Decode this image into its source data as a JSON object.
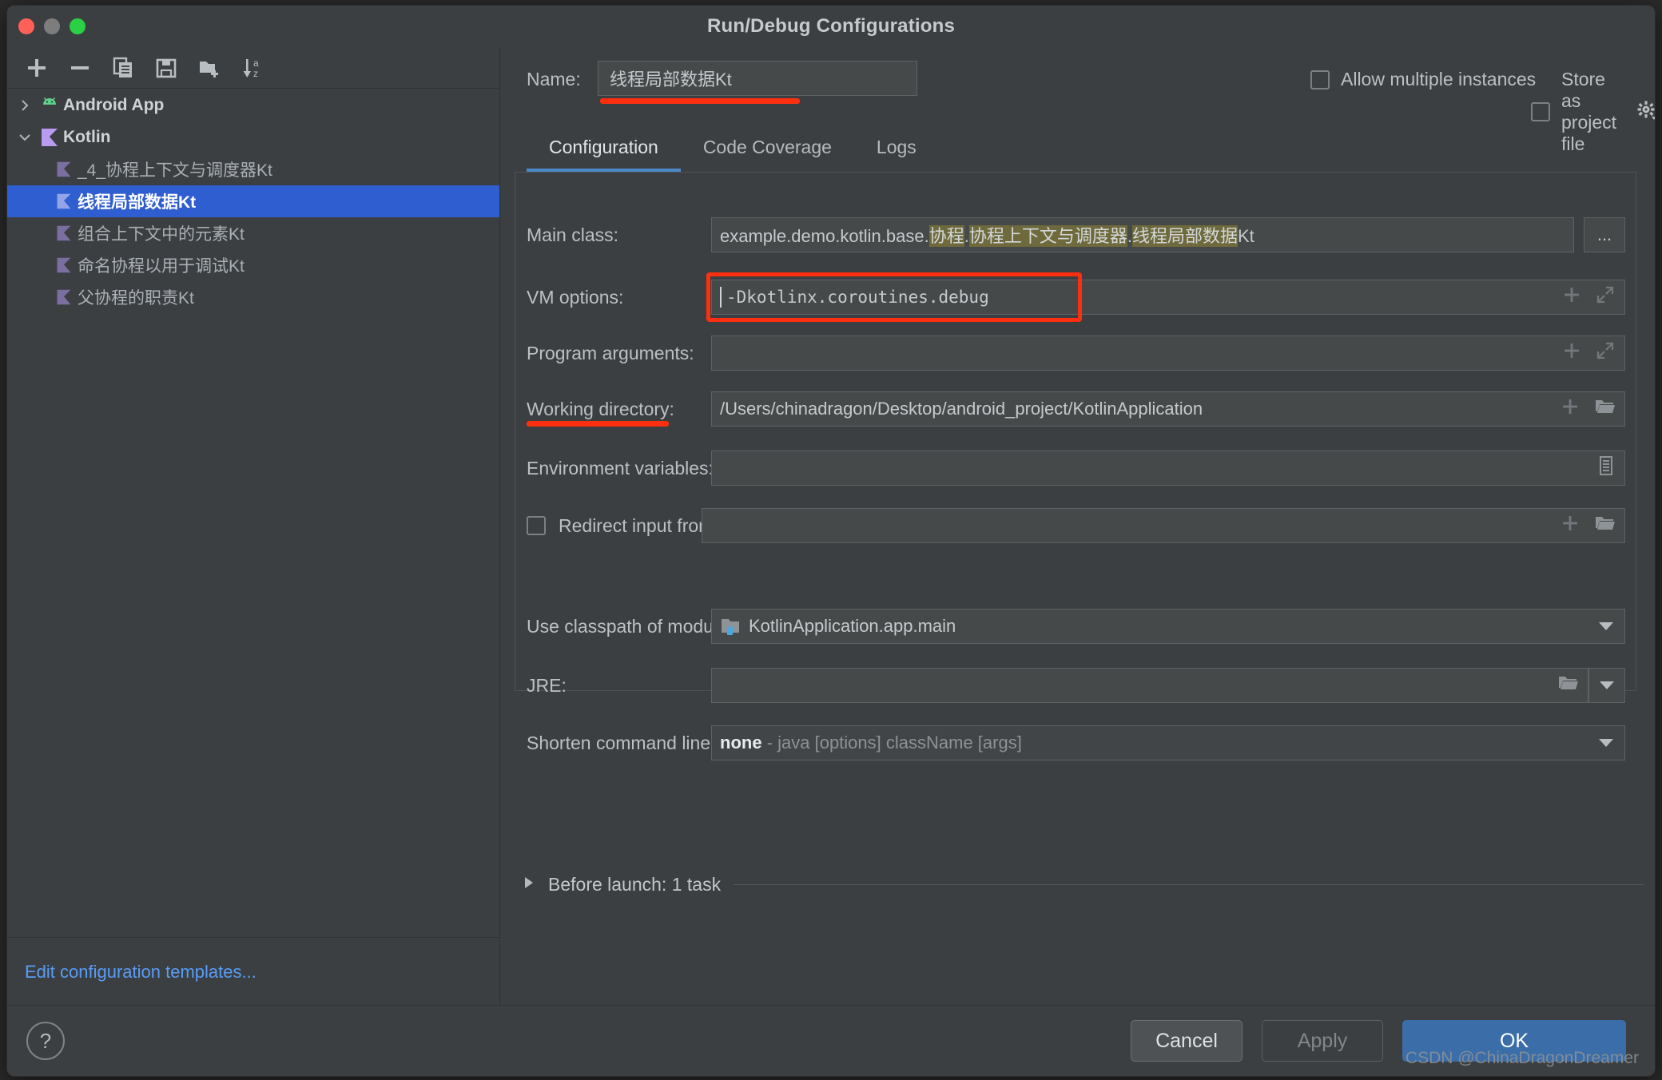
{
  "window": {
    "title": "Run/Debug Configurations",
    "traffic": [
      "close",
      "minimize",
      "maximize"
    ]
  },
  "sidebar": {
    "toolbar": [
      {
        "name": "add-configuration-button",
        "icon": "plus-icon"
      },
      {
        "name": "remove-configuration-button",
        "icon": "minus-icon"
      },
      {
        "name": "copy-configuration-button",
        "icon": "copy-icon"
      },
      {
        "name": "save-configuration-button",
        "icon": "save-icon"
      },
      {
        "name": "new-folder-button",
        "icon": "new-folder-icon"
      },
      {
        "name": "sort-configurations-button",
        "icon": "sort-az-icon"
      }
    ],
    "tree": [
      {
        "label": "Android App",
        "type": "group",
        "twisty": "chevron-right-icon",
        "icon": "android-icon",
        "selected": false
      },
      {
        "label": "Kotlin",
        "type": "group",
        "twisty": "chevron-down-icon",
        "icon": "kotlin-icon",
        "selected": false
      },
      {
        "label": "_4_协程上下文与调度器Kt",
        "type": "leaf",
        "icon": "kotlin-file-icon",
        "selected": false
      },
      {
        "label": "线程局部数据Kt",
        "type": "leaf",
        "icon": "kotlin-file-icon",
        "selected": true
      },
      {
        "label": "组合上下文中的元素Kt",
        "type": "leaf",
        "icon": "kotlin-file-icon",
        "selected": false
      },
      {
        "label": "命名协程以用于调试Kt",
        "type": "leaf",
        "icon": "kotlin-file-icon",
        "selected": false
      },
      {
        "label": "父协程的职责Kt",
        "type": "leaf",
        "icon": "kotlin-file-icon",
        "selected": false
      }
    ],
    "edit_templates_link": "Edit configuration templates..."
  },
  "main": {
    "name_label": "Name:",
    "name_value": "线程局部数据Kt",
    "allow_multiple_instances": {
      "label": "Allow multiple instances",
      "checked": false
    },
    "store_as_project_file": {
      "label": "Store as project file",
      "checked": false
    },
    "tabs": [
      {
        "label": "Configuration",
        "active": true
      },
      {
        "label": "Code Coverage",
        "active": false
      },
      {
        "label": "Logs",
        "active": false
      }
    ],
    "fields": {
      "main_class": {
        "label": "Main class:",
        "value_plain": "example.demo.kotlin.base.",
        "value_hl1": "协程",
        "sep1": ".",
        "value_hl2": "协程上下文与调度器",
        "sep2": ".",
        "value_hl3": "线程局部数据",
        "value_tail": "Kt",
        "browse_label": "..."
      },
      "vm_options": {
        "label": "VM options:",
        "value": "-Dkotlinx.coroutines.debug"
      },
      "program_arguments": {
        "label": "Program arguments:",
        "value": ""
      },
      "working_directory": {
        "label": "Working directory:",
        "value": "/Users/chinadragon/Desktop/android_project/KotlinApplication"
      },
      "environment_variables": {
        "label": "Environment variables:",
        "value": ""
      },
      "redirect_input_from": {
        "label": "Redirect input from:",
        "value": "",
        "checked": false
      },
      "use_classpath_of_module": {
        "label": "Use classpath of module:",
        "value": "KotlinApplication.app.main"
      },
      "jre": {
        "label": "JRE:",
        "value": ""
      },
      "shorten_command_line": {
        "label": "Shorten command line:",
        "value_strong": "none",
        "value_rest": "- java [options] className [args]"
      }
    },
    "before_launch": {
      "label": "Before launch: 1 task",
      "twisty": "triangle-right-icon"
    }
  },
  "footer": {
    "help": "?",
    "cancel": "Cancel",
    "apply": "Apply",
    "ok": "OK",
    "watermark": "CSDN @ChinaDragonDreamer"
  },
  "colors": {
    "background": "#3c3f41",
    "selection": "#2f5ed0",
    "accent": "#4a88c7",
    "link": "#589df6",
    "annotation": "#fc2f10",
    "highlight": "#6e6a3c",
    "ok_button": "#3b6ea8"
  }
}
